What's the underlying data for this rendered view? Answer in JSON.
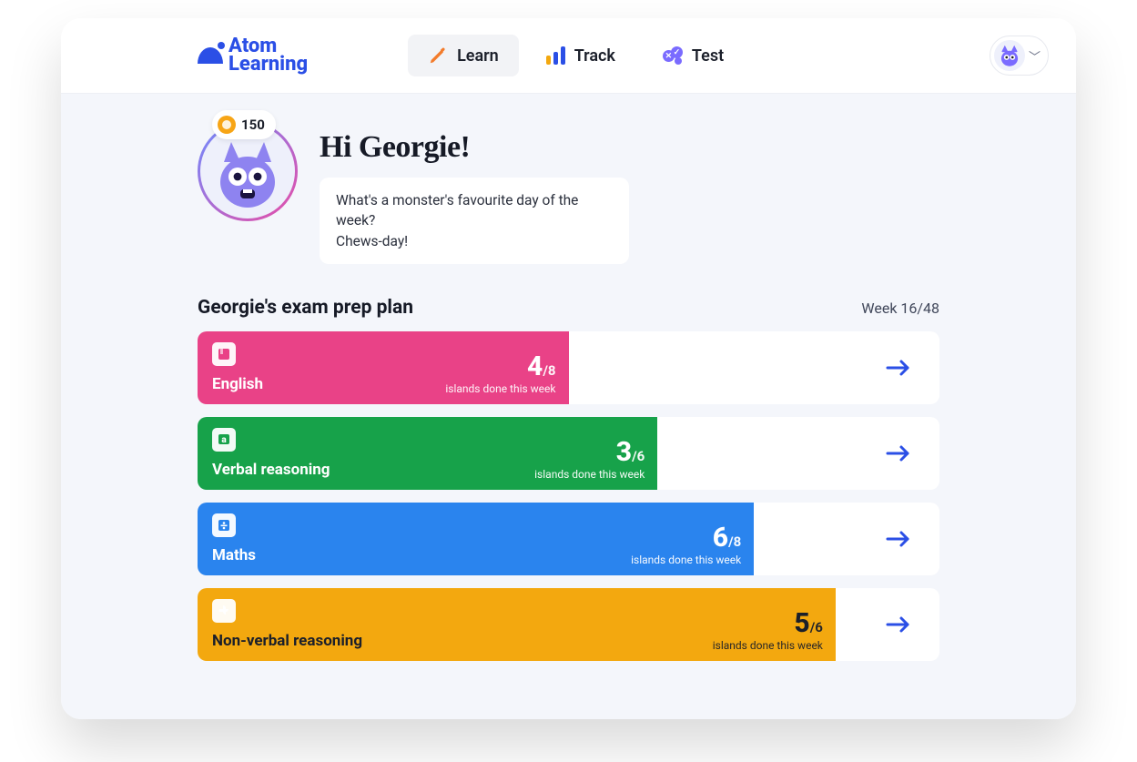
{
  "brand": {
    "line1": "Atom",
    "line2": "Learning"
  },
  "nav": {
    "learn": "Learn",
    "track": "Track",
    "test": "Test",
    "active": "learn"
  },
  "coins": "150",
  "greeting": {
    "title": "Hi Georgie!",
    "joke_line1": "What's a monster's favourite day of the week?",
    "joke_line2": "Chews-day!"
  },
  "plan": {
    "title": "Georgie's exam prep plan",
    "week_label": "Week 16/48",
    "caption": "islands done this week",
    "subjects": [
      {
        "name": "English",
        "done": "4",
        "total": "/8",
        "color": "c-pink",
        "fill_pct": 50
      },
      {
        "name": "Verbal reasoning",
        "done": "3",
        "total": "/6",
        "color": "c-green",
        "fill_pct": 62
      },
      {
        "name": "Maths",
        "done": "6",
        "total": "/8",
        "color": "c-blue",
        "fill_pct": 75
      },
      {
        "name": "Non-verbal reasoning",
        "done": "5",
        "total": "/6",
        "color": "c-yellow",
        "fill_pct": 86
      }
    ]
  }
}
